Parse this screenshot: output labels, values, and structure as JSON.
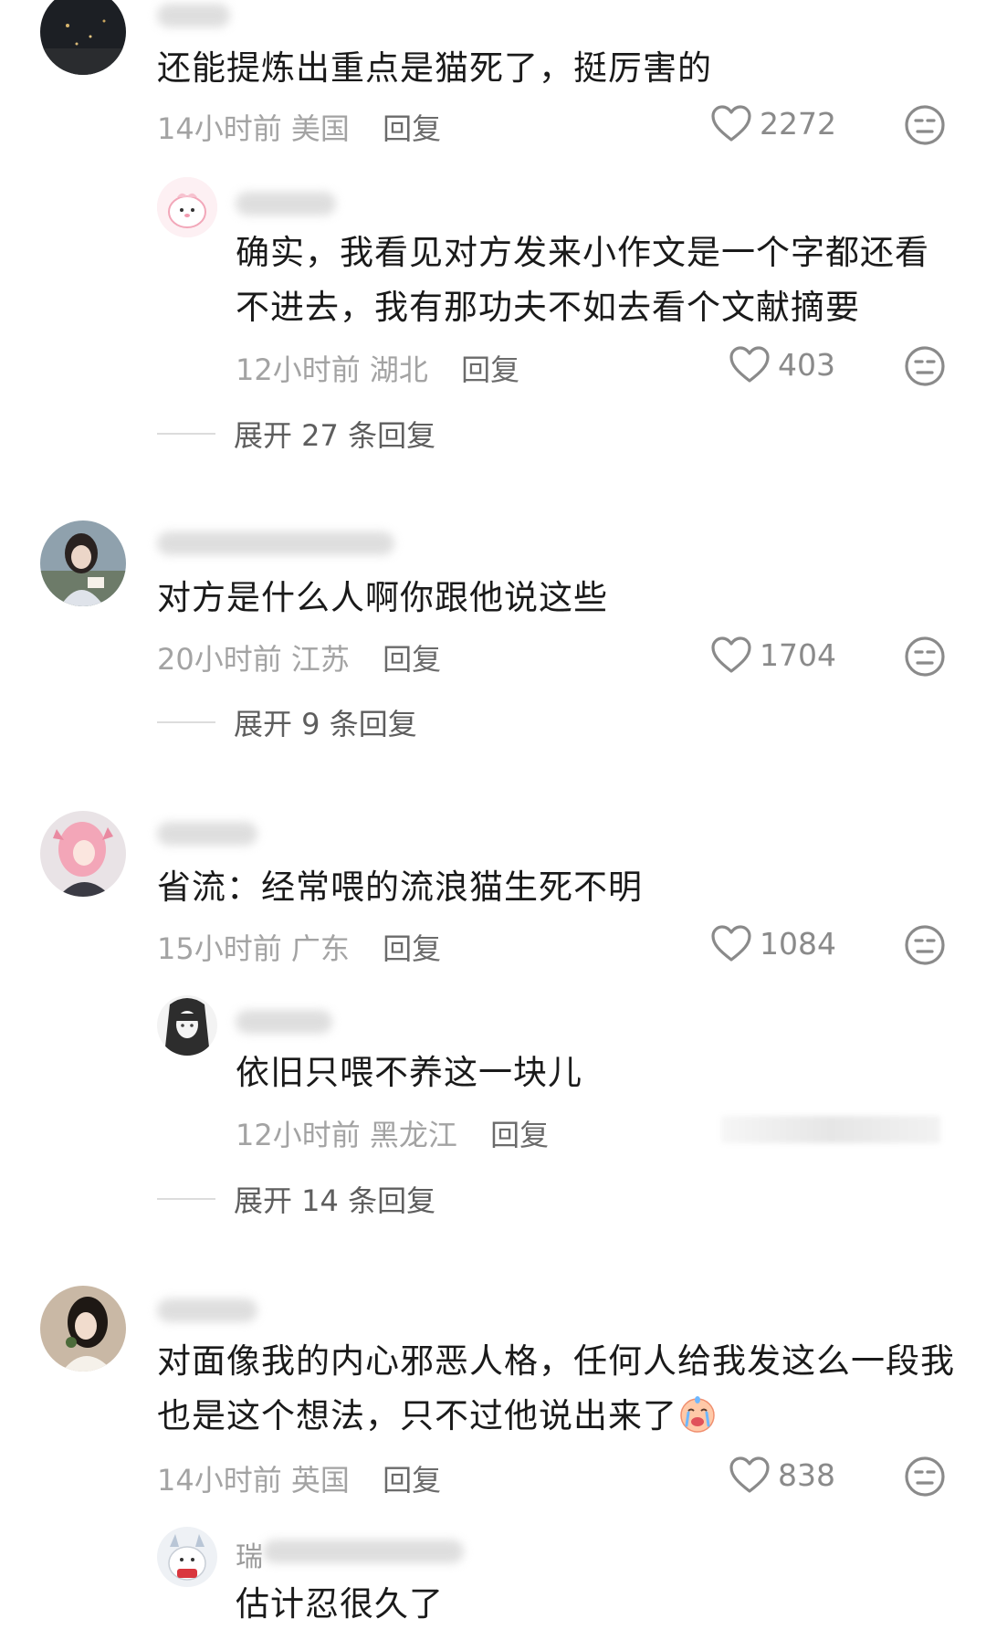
{
  "comments": [
    {
      "text": "还能提炼出重点是猫死了，挺厉害的",
      "time": "14小时前",
      "location": "美国",
      "reply_label": "回复",
      "likes": "2272",
      "replies": [
        {
          "text_lines": [
            "确实，我看见对方发来小作文是一个字都还看",
            "不进去，我有那功夫不如去看个文献摘要"
          ],
          "time": "12小时前",
          "location": "湖北",
          "reply_label": "回复",
          "likes": "403"
        }
      ],
      "expand_label": "展开 27 条回复"
    },
    {
      "text": "对方是什么人啊你跟他说这些",
      "time": "20小时前",
      "location": "江苏",
      "reply_label": "回复",
      "likes": "1704",
      "expand_label": "展开 9 条回复"
    },
    {
      "text": "省流：经常喂的流浪猫生死不明",
      "time": "15小时前",
      "location": "广东",
      "reply_label": "回复",
      "likes": "1084",
      "replies": [
        {
          "text": "依旧只喂不养这一块儿",
          "time": "12小时前",
          "location": "黑龙江",
          "reply_label": "回复"
        }
      ],
      "expand_label": "展开 14 条回复"
    },
    {
      "text_lines": [
        "对面像我的内心邪恶人格，任何人给我发这么一段我",
        "也是这个想法，只不过他说出来了"
      ],
      "time": "14小时前",
      "location": "英国",
      "reply_label": "回复",
      "likes": "838",
      "replies": [
        {
          "username_partial": "瑞",
          "text": "估计忍很久了"
        }
      ]
    }
  ],
  "icons": {
    "like": "heart-outline-icon",
    "dislike": "meh-face-icon",
    "crying_emoji": "crying-face-emoji"
  },
  "colors": {
    "text": "#1a1a1a",
    "meta": "#a3a3a3",
    "reply": "#6b6b6b",
    "icon": "#8a8a8a"
  }
}
